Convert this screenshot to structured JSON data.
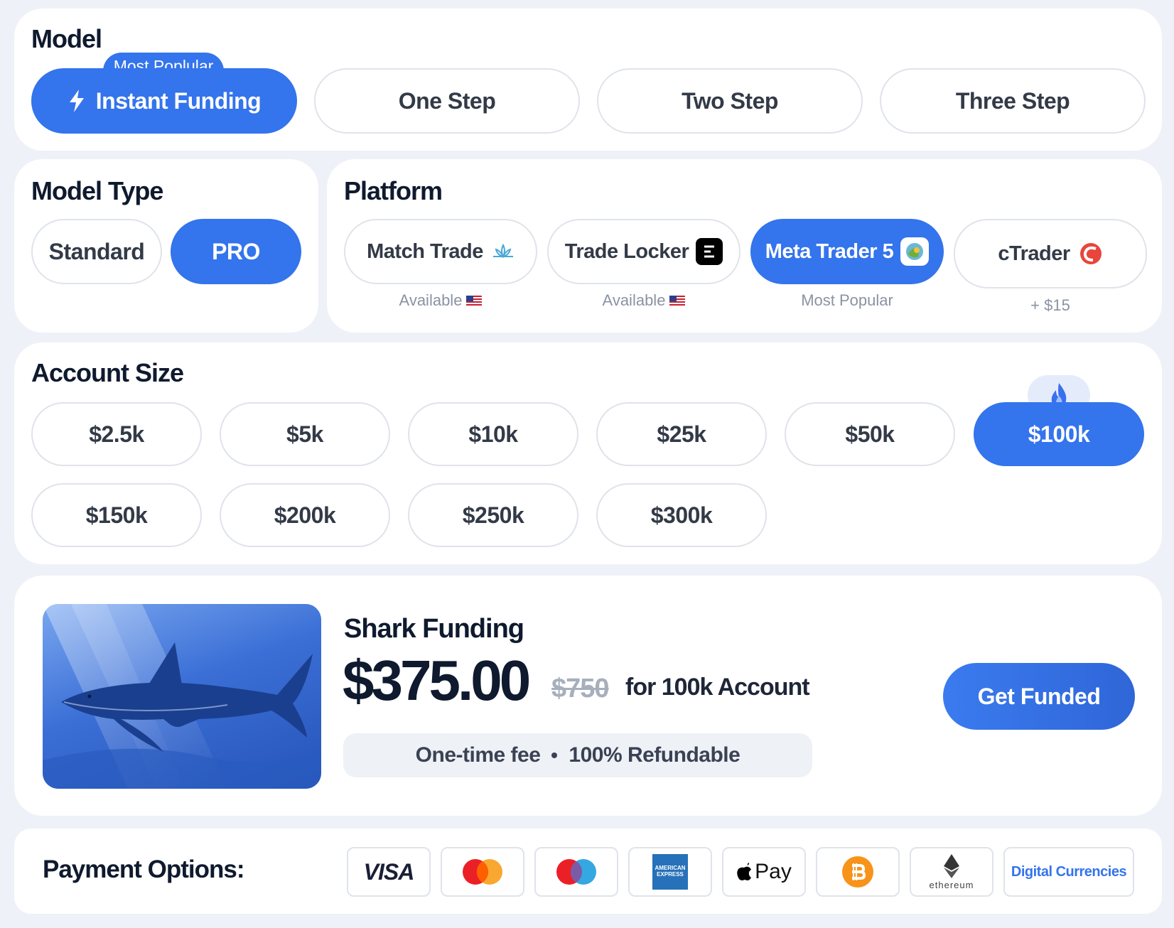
{
  "model": {
    "title": "Model",
    "badge": "Most Poplular",
    "options": [
      {
        "label": "Instant Funding",
        "active": true
      },
      {
        "label": "One Step",
        "active": false
      },
      {
        "label": "Two Step",
        "active": false
      },
      {
        "label": "Three Step",
        "active": false
      }
    ]
  },
  "model_type": {
    "title": "Model Type",
    "options": [
      {
        "label": "Standard",
        "active": false
      },
      {
        "label": "PRO",
        "active": true
      }
    ]
  },
  "platform": {
    "title": "Platform",
    "options": [
      {
        "label": "Match Trade",
        "sub": "Available",
        "icon": "match-trade-logo-icon",
        "active": false
      },
      {
        "label": "Trade Locker",
        "sub": "Available",
        "icon": "trade-locker-logo-icon",
        "active": false
      },
      {
        "label": "Meta Trader 5",
        "sub": "Most Popular",
        "icon": "metatrader-logo-icon",
        "active": true
      },
      {
        "label": "cTrader",
        "sub": "+ $15",
        "icon": "ctrader-logo-icon",
        "active": false
      }
    ]
  },
  "account_size": {
    "title": "Account Size",
    "options": [
      {
        "label": "$2.5k",
        "active": false
      },
      {
        "label": "$5k",
        "active": false
      },
      {
        "label": "$10k",
        "active": false
      },
      {
        "label": "$25k",
        "active": false
      },
      {
        "label": "$50k",
        "active": false
      },
      {
        "label": "$100k",
        "active": true
      },
      {
        "label": "$150k",
        "active": false
      },
      {
        "label": "$200k",
        "active": false
      },
      {
        "label": "$250k",
        "active": false
      },
      {
        "label": "$300k",
        "active": false
      }
    ],
    "hot_icon": "fire-icon"
  },
  "summary": {
    "title": "Shark Funding",
    "price": "$375.00",
    "old_price": "$750",
    "for_text": "for 100k Account",
    "fee_text": "One-time fee",
    "refund_text": "100% Refundable",
    "cta": "Get Funded"
  },
  "payment": {
    "title": "Payment Options:",
    "methods": [
      "visa-icon",
      "mastercard-icon",
      "maestro-icon",
      "amex-icon",
      "apple-pay-icon",
      "bitcoin-icon",
      "ethereum-icon",
      "Digital Currencies"
    ],
    "visa": "VISA",
    "amex_line1": "AMERICAN",
    "amex_line2": "EXPRESS",
    "applepay": "Pay",
    "ethereum": "ethereum",
    "digital": "Digital Currencies"
  },
  "colors": {
    "accent": "#3474ec",
    "background": "#eef1f7",
    "card": "#ffffff",
    "text": "#0f1a2e",
    "muted": "#8a93a3"
  }
}
